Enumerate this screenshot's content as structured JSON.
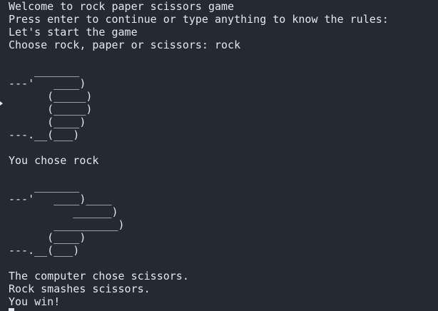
{
  "terminal": {
    "lines_intro": [
      "Welcome to rock paper scissors game",
      "Press enter to continue or type anything to know the rules:",
      "Let's start the game",
      "Choose rock, paper or scissors: rock"
    ],
    "player_art": "    _______\n---'   ____)\n      (_____)\n      (_____)\n      (____)\n---.__(___)",
    "player_choice": "You chose rock",
    "computer_art": "    _______\n---'   ____)____\n          ______)\n       __________)\n      (____)\n---.__(___)",
    "result_lines": [
      "The computer chose scissors.",
      "Rock smashes scissors.",
      "You win!"
    ]
  }
}
